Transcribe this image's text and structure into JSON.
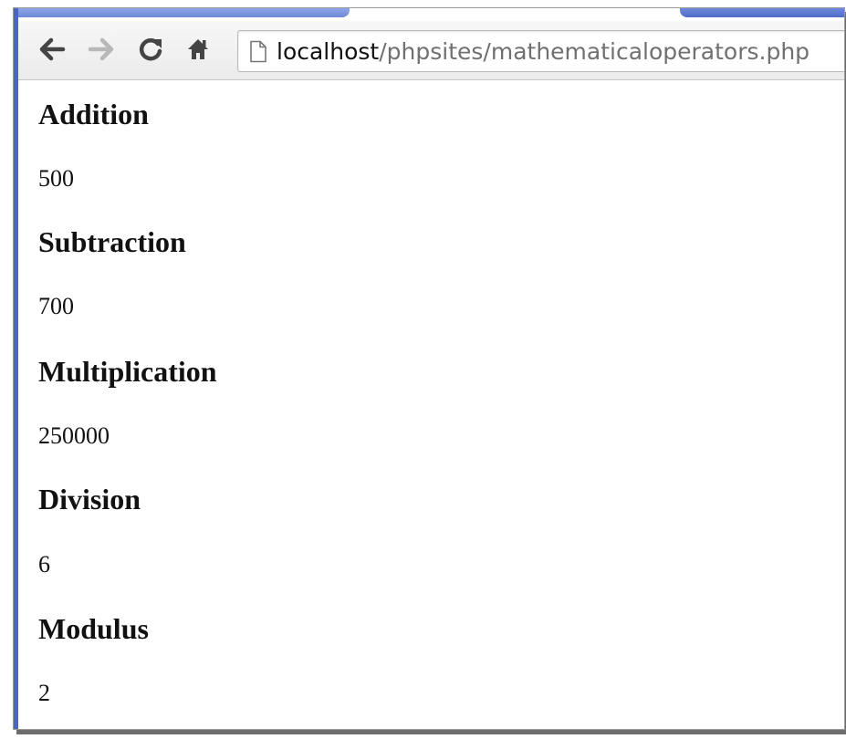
{
  "browser": {
    "url_host": "localhost",
    "url_path": "/phpsites/mathematicaloperators.php",
    "accent_color": "#4a66c4"
  },
  "icons": [
    "back-icon",
    "forward-icon",
    "reload-icon",
    "home-icon",
    "page-icon"
  ],
  "sections": [
    {
      "title": "Addition",
      "value": "500"
    },
    {
      "title": "Subtraction",
      "value": "700"
    },
    {
      "title": "Multiplication",
      "value": "250000"
    },
    {
      "title": "Division",
      "value": "6"
    },
    {
      "title": "Modulus",
      "value": "2"
    }
  ]
}
